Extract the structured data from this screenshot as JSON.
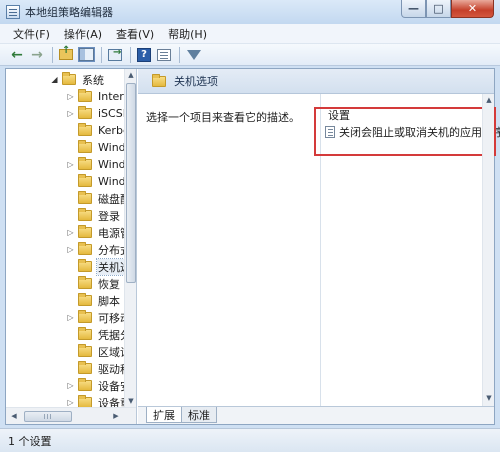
{
  "window": {
    "title": "本地组策略编辑器",
    "min_label": "—",
    "max_label": "□",
    "close_label": "✕"
  },
  "menu": [
    {
      "label": "文件(F)"
    },
    {
      "label": "操作(A)"
    },
    {
      "label": "查看(V)"
    },
    {
      "label": "帮助(H)"
    }
  ],
  "toolbar": {
    "back_icon": "←",
    "forward_icon": "→",
    "help_label": "?"
  },
  "tree": {
    "items": [
      {
        "label": "系统",
        "expander": "open"
      },
      {
        "label": "Intern",
        "expander": "closed"
      },
      {
        "label": "iSCSI",
        "expander": "closed"
      },
      {
        "label": "Kerbe",
        "expander": "none"
      },
      {
        "label": "Windo",
        "expander": "none"
      },
      {
        "label": "Windo",
        "expander": "closed"
      },
      {
        "label": "Windo",
        "expander": "none"
      },
      {
        "label": "磁盘配",
        "expander": "none"
      },
      {
        "label": "登录",
        "expander": "none"
      },
      {
        "label": "电源管",
        "expander": "closed"
      },
      {
        "label": "分布式",
        "expander": "closed"
      },
      {
        "label": "关机选",
        "expander": "none",
        "selected": true
      },
      {
        "label": "恢复",
        "expander": "none"
      },
      {
        "label": "脚本",
        "expander": "none"
      },
      {
        "label": "可移动",
        "expander": "closed"
      },
      {
        "label": "凭据分",
        "expander": "none"
      },
      {
        "label": "区域设",
        "expander": "none"
      },
      {
        "label": "驱动程",
        "expander": "none"
      },
      {
        "label": "设备安",
        "expander": "closed"
      },
      {
        "label": "设备重",
        "expander": "closed"
      }
    ],
    "hscroll_grip": "III"
  },
  "content": {
    "header_title": "关机选项",
    "description": "选择一个项目来查看它的描述。",
    "settings_header": "设置",
    "settings": [
      {
        "label": "关闭会阻止或取消关机的应用程序的"
      }
    ],
    "highlight_color": "#d43a3a"
  },
  "tabs": [
    {
      "label": "扩展",
      "active": true
    },
    {
      "label": "标准",
      "active": false
    }
  ],
  "status": {
    "text": "1 个设置"
  }
}
